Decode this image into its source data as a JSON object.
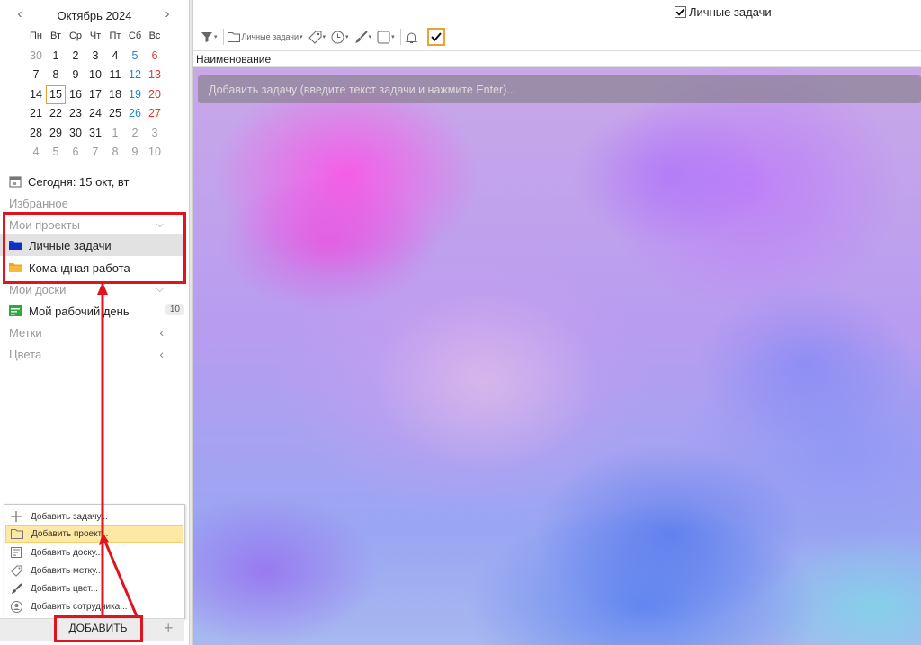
{
  "calendar": {
    "title": "Октябрь 2024",
    "weekdays": [
      "Пн",
      "Вт",
      "Ср",
      "Чт",
      "Пт",
      "Сб",
      "Вс"
    ],
    "weeks": [
      [
        "30",
        "1",
        "2",
        "3",
        "4",
        "5",
        "6"
      ],
      [
        "7",
        "8",
        "9",
        "10",
        "11",
        "12",
        "13"
      ],
      [
        "14",
        "15",
        "16",
        "17",
        "18",
        "19",
        "20"
      ],
      [
        "21",
        "22",
        "23",
        "24",
        "25",
        "26",
        "27"
      ],
      [
        "28",
        "29",
        "30",
        "31",
        "1",
        "2",
        "3"
      ],
      [
        "4",
        "5",
        "6",
        "7",
        "8",
        "9",
        "10"
      ]
    ],
    "today": "15"
  },
  "sidebar": {
    "today_label": "Сегодня: 15 окт, вт",
    "favorites": "Избранное",
    "my_projects": "Мои проекты",
    "projects": [
      {
        "label": "Личные задачи",
        "color": "#1a3fe0"
      },
      {
        "label": "Командная работа",
        "color": "#f4a21c"
      }
    ],
    "my_boards": "Мои доски",
    "boards": [
      {
        "label": "Мой рабочий день",
        "count": "10"
      }
    ],
    "tags": "Метки",
    "colors": "Цвета"
  },
  "menu": {
    "items": [
      {
        "label": "Добавить задачу...",
        "icon": "plus-icon"
      },
      {
        "label": "Добавить проект...",
        "icon": "folder-icon"
      },
      {
        "label": "Добавить доску...",
        "icon": "board-icon"
      },
      {
        "label": "Добавить метку...",
        "icon": "tag-icon"
      },
      {
        "label": "Добавить цвет...",
        "icon": "brush-icon"
      },
      {
        "label": "Добавить сотрудника...",
        "icon": "user-icon"
      }
    ]
  },
  "footer": {
    "add_label": "ДОБАВИТЬ"
  },
  "main": {
    "filter_label": "Личные задачи",
    "toolbar_project": "Личные задачи",
    "column_header": "Наименование",
    "task_placeholder": "Добавить задачу (введите текст задачи и нажмите Enter)..."
  },
  "colors": {
    "highlight": "#e0141e",
    "accent": "#f0a030"
  }
}
